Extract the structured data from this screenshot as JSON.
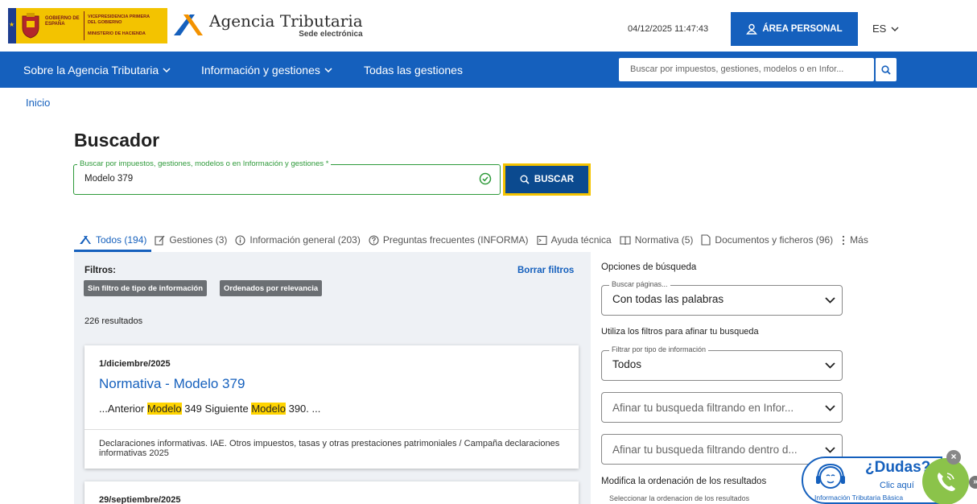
{
  "header": {
    "gov_name": "GOBIERNO DE ESPAÑA",
    "vice_name": "VICEPRESIDENCIA PRIMERA DEL GOBIERNO",
    "ministry_name": "MINISTERIO DE HACIENDA",
    "agency_title": "Agencia Tributaria",
    "agency_subtitle": "Sede electrónica",
    "datetime": "04/12/2025 11:47:43",
    "area_personal_label": "ÁREA PERSONAL",
    "language": "ES"
  },
  "nav": {
    "items": [
      {
        "label": "Sobre la Agencia Tributaria"
      },
      {
        "label": "Información y gestiones"
      },
      {
        "label": "Todas las gestiones"
      }
    ],
    "search_placeholder": "Buscar por impuestos, gestiones, modelos o en Infor..."
  },
  "breadcrumb": "Inicio",
  "page_title": "Buscador",
  "search": {
    "legend": "Buscar por impuestos, gestiones, modelos o en Información y gestiones *",
    "value": "Modelo 379",
    "button_label": "BUSCAR"
  },
  "tabs": [
    {
      "label": "Todos (194)",
      "icon": "agency-logo-icon"
    },
    {
      "label": "Gestiones (3)",
      "icon": "edit-icon"
    },
    {
      "label": "Información general (203)",
      "icon": "info-icon"
    },
    {
      "label": "Preguntas frecuentes (INFORMA)",
      "icon": "question-icon"
    },
    {
      "label": "Ayuda técnica",
      "icon": "terminal-icon"
    },
    {
      "label": "Normativa (5)",
      "icon": "book-icon"
    },
    {
      "label": "Documentos y ficheros (96)",
      "icon": "document-icon"
    },
    {
      "label": "Más",
      "icon": "more-icon"
    }
  ],
  "filters": {
    "title": "Filtros:",
    "clear_label": "Borrar filtros",
    "chips": [
      "Sin filtro de tipo de información",
      "Ordenados por relevancia"
    ],
    "result_count": "226 resultados"
  },
  "results": [
    {
      "date": "1/diciembre/2025",
      "title": "Normativa - Modelo 379",
      "snippet_parts": [
        "...Anterior ",
        "Modelo",
        " 349 Siguiente ",
        "Modelo",
        " 390. ..."
      ],
      "tags": "Declaraciones informativas. IAE. Otros impuestos, tasas y otras prestaciones patrimoniales / Campaña declaraciones informativas 2025"
    },
    {
      "date": "29/septiembre/2025"
    }
  ],
  "options": {
    "title": "Opciones de búsqueda",
    "search_pages_legend": "Buscar páginas...",
    "search_pages_value": "Con todas las palabras",
    "filter_title": "Utiliza los filtros para afinar tu busqueda",
    "type_legend": "Filtrar por tipo de información",
    "type_value": "Todos",
    "refine_info_placeholder": "Afinar tu busqueda filtrando en Infor...",
    "refine_within_placeholder": "Afinar tu busqueda filtrando dentro d...",
    "order_title": "Modifica la ordenación de los resultados",
    "order_legend": "Seleccionar la ordenacion de los resultados"
  },
  "help_widget": {
    "title": "¿Dudas?",
    "click": "Clic aquí",
    "subtitle": "Información Tributaria Básica"
  },
  "colors": {
    "primary": "#1560bd",
    "dark_button": "#0b4a8f",
    "focus": "#f4c300",
    "valid": "#2e9a3a",
    "highlight": "#ffd400"
  }
}
